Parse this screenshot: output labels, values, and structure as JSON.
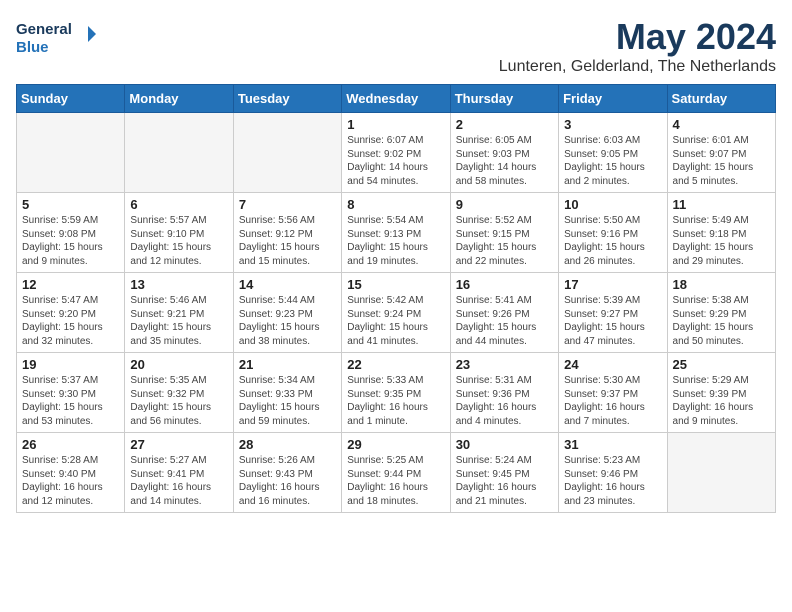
{
  "header": {
    "logo_line1": "General",
    "logo_line2": "Blue",
    "month_title": "May 2024",
    "location": "Lunteren, Gelderland, The Netherlands"
  },
  "weekdays": [
    "Sunday",
    "Monday",
    "Tuesday",
    "Wednesday",
    "Thursday",
    "Friday",
    "Saturday"
  ],
  "weeks": [
    [
      {
        "day": "",
        "info": ""
      },
      {
        "day": "",
        "info": ""
      },
      {
        "day": "",
        "info": ""
      },
      {
        "day": "1",
        "info": "Sunrise: 6:07 AM\nSunset: 9:02 PM\nDaylight: 14 hours\nand 54 minutes."
      },
      {
        "day": "2",
        "info": "Sunrise: 6:05 AM\nSunset: 9:03 PM\nDaylight: 14 hours\nand 58 minutes."
      },
      {
        "day": "3",
        "info": "Sunrise: 6:03 AM\nSunset: 9:05 PM\nDaylight: 15 hours\nand 2 minutes."
      },
      {
        "day": "4",
        "info": "Sunrise: 6:01 AM\nSunset: 9:07 PM\nDaylight: 15 hours\nand 5 minutes."
      }
    ],
    [
      {
        "day": "5",
        "info": "Sunrise: 5:59 AM\nSunset: 9:08 PM\nDaylight: 15 hours\nand 9 minutes."
      },
      {
        "day": "6",
        "info": "Sunrise: 5:57 AM\nSunset: 9:10 PM\nDaylight: 15 hours\nand 12 minutes."
      },
      {
        "day": "7",
        "info": "Sunrise: 5:56 AM\nSunset: 9:12 PM\nDaylight: 15 hours\nand 15 minutes."
      },
      {
        "day": "8",
        "info": "Sunrise: 5:54 AM\nSunset: 9:13 PM\nDaylight: 15 hours\nand 19 minutes."
      },
      {
        "day": "9",
        "info": "Sunrise: 5:52 AM\nSunset: 9:15 PM\nDaylight: 15 hours\nand 22 minutes."
      },
      {
        "day": "10",
        "info": "Sunrise: 5:50 AM\nSunset: 9:16 PM\nDaylight: 15 hours\nand 26 minutes."
      },
      {
        "day": "11",
        "info": "Sunrise: 5:49 AM\nSunset: 9:18 PM\nDaylight: 15 hours\nand 29 minutes."
      }
    ],
    [
      {
        "day": "12",
        "info": "Sunrise: 5:47 AM\nSunset: 9:20 PM\nDaylight: 15 hours\nand 32 minutes."
      },
      {
        "day": "13",
        "info": "Sunrise: 5:46 AM\nSunset: 9:21 PM\nDaylight: 15 hours\nand 35 minutes."
      },
      {
        "day": "14",
        "info": "Sunrise: 5:44 AM\nSunset: 9:23 PM\nDaylight: 15 hours\nand 38 minutes."
      },
      {
        "day": "15",
        "info": "Sunrise: 5:42 AM\nSunset: 9:24 PM\nDaylight: 15 hours\nand 41 minutes."
      },
      {
        "day": "16",
        "info": "Sunrise: 5:41 AM\nSunset: 9:26 PM\nDaylight: 15 hours\nand 44 minutes."
      },
      {
        "day": "17",
        "info": "Sunrise: 5:39 AM\nSunset: 9:27 PM\nDaylight: 15 hours\nand 47 minutes."
      },
      {
        "day": "18",
        "info": "Sunrise: 5:38 AM\nSunset: 9:29 PM\nDaylight: 15 hours\nand 50 minutes."
      }
    ],
    [
      {
        "day": "19",
        "info": "Sunrise: 5:37 AM\nSunset: 9:30 PM\nDaylight: 15 hours\nand 53 minutes."
      },
      {
        "day": "20",
        "info": "Sunrise: 5:35 AM\nSunset: 9:32 PM\nDaylight: 15 hours\nand 56 minutes."
      },
      {
        "day": "21",
        "info": "Sunrise: 5:34 AM\nSunset: 9:33 PM\nDaylight: 15 hours\nand 59 minutes."
      },
      {
        "day": "22",
        "info": "Sunrise: 5:33 AM\nSunset: 9:35 PM\nDaylight: 16 hours\nand 1 minute."
      },
      {
        "day": "23",
        "info": "Sunrise: 5:31 AM\nSunset: 9:36 PM\nDaylight: 16 hours\nand 4 minutes."
      },
      {
        "day": "24",
        "info": "Sunrise: 5:30 AM\nSunset: 9:37 PM\nDaylight: 16 hours\nand 7 minutes."
      },
      {
        "day": "25",
        "info": "Sunrise: 5:29 AM\nSunset: 9:39 PM\nDaylight: 16 hours\nand 9 minutes."
      }
    ],
    [
      {
        "day": "26",
        "info": "Sunrise: 5:28 AM\nSunset: 9:40 PM\nDaylight: 16 hours\nand 12 minutes."
      },
      {
        "day": "27",
        "info": "Sunrise: 5:27 AM\nSunset: 9:41 PM\nDaylight: 16 hours\nand 14 minutes."
      },
      {
        "day": "28",
        "info": "Sunrise: 5:26 AM\nSunset: 9:43 PM\nDaylight: 16 hours\nand 16 minutes."
      },
      {
        "day": "29",
        "info": "Sunrise: 5:25 AM\nSunset: 9:44 PM\nDaylight: 16 hours\nand 18 minutes."
      },
      {
        "day": "30",
        "info": "Sunrise: 5:24 AM\nSunset: 9:45 PM\nDaylight: 16 hours\nand 21 minutes."
      },
      {
        "day": "31",
        "info": "Sunrise: 5:23 AM\nSunset: 9:46 PM\nDaylight: 16 hours\nand 23 minutes."
      },
      {
        "day": "",
        "info": ""
      }
    ]
  ]
}
